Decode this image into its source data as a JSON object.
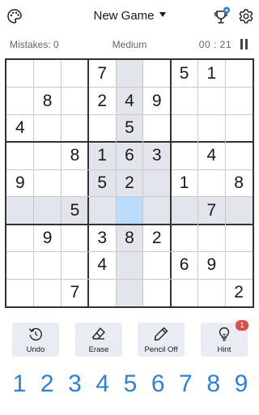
{
  "header": {
    "title": "New Game",
    "icons": [
      "palette-icon",
      "trophy-icon",
      "gear-icon"
    ]
  },
  "status": {
    "mistakes": "Mistakes: 0",
    "difficulty": "Medium",
    "timer": "00 : 21",
    "pause_icon": "pause-icon"
  },
  "board": {
    "selected": [
      5,
      4
    ],
    "grid": [
      [
        "",
        "",
        "",
        "7",
        "",
        "",
        "5",
        "1",
        ""
      ],
      [
        "",
        "8",
        "",
        "2",
        "4",
        "9",
        "",
        "",
        ""
      ],
      [
        "4",
        "",
        "",
        "",
        "5",
        "",
        "",
        "",
        ""
      ],
      [
        "",
        "",
        "8",
        "1",
        "6",
        "3",
        "",
        "4",
        ""
      ],
      [
        "9",
        "",
        "",
        "5",
        "2",
        "",
        "1",
        "",
        "8"
      ],
      [
        "",
        "",
        "5",
        "",
        "",
        "",
        "",
        "7",
        ""
      ],
      [
        "",
        "9",
        "",
        "3",
        "8",
        "2",
        "",
        "",
        ""
      ],
      [
        "",
        "",
        "",
        "4",
        "",
        "",
        "6",
        "9",
        ""
      ],
      [
        "",
        "",
        "7",
        "",
        "",
        "",
        "",
        "",
        "2"
      ]
    ]
  },
  "actions": {
    "undo": "Undo",
    "erase": "Erase",
    "pencil": "Pencil Off",
    "hint": "Hint",
    "hint_badge": "1"
  },
  "numpad": [
    "1",
    "2",
    "3",
    "4",
    "5",
    "6",
    "7",
    "8",
    "9"
  ],
  "colors": {
    "accent": "#2f7fd6",
    "highlight": "#e2e6ec",
    "selected": "#bcdcfb",
    "badge": "#d8504b"
  }
}
